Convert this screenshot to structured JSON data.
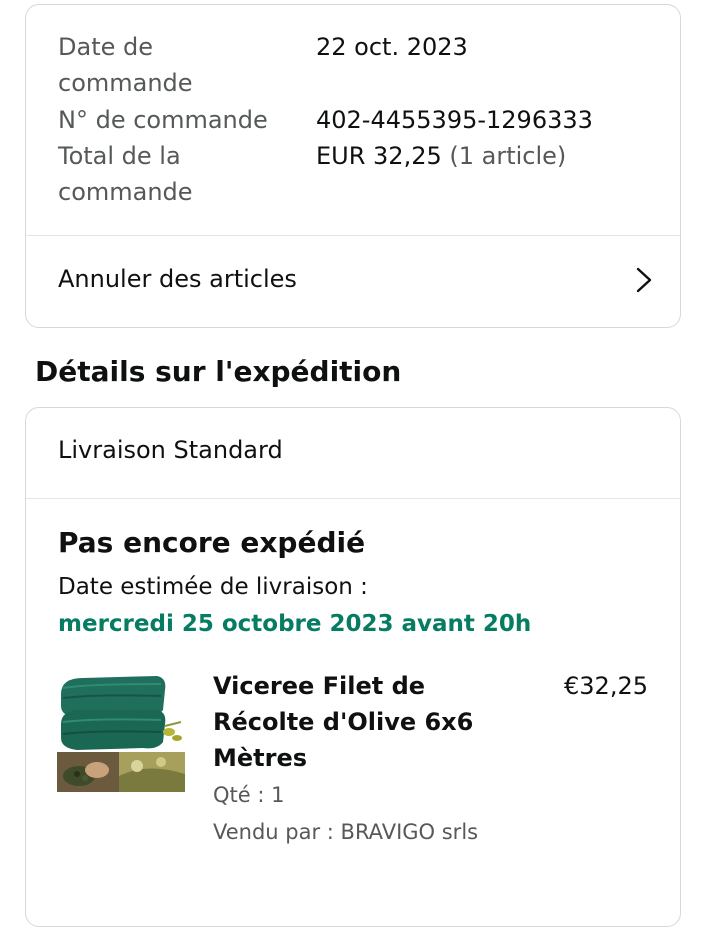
{
  "order": {
    "date_label": "Date de commande",
    "date_value": "22 oct. 2023",
    "number_label": "N° de commande",
    "number_value": "402-4455395-1296333",
    "total_label": "Total de la commande",
    "total_value": "EUR 32,25",
    "total_items": "(1 article)",
    "cancel_label": "Annuler des articles",
    "cancel_icon": "chevron-right-icon"
  },
  "shipping": {
    "section_title": "Détails sur l'expédition",
    "method": "Livraison Standard",
    "status": "Pas encore expédié",
    "estimate_label": "Date estimée de livraison :",
    "estimate_date": "mercredi 25 octobre 2023 avant 20h",
    "estimate_color": "#067d62"
  },
  "item": {
    "title": "Viceree Filet de Récolte d'Olive 6x6 Mètres",
    "price": "€32,25",
    "quantity": "Qté : 1",
    "seller": "Vendu par : BRAVIGO srls"
  }
}
